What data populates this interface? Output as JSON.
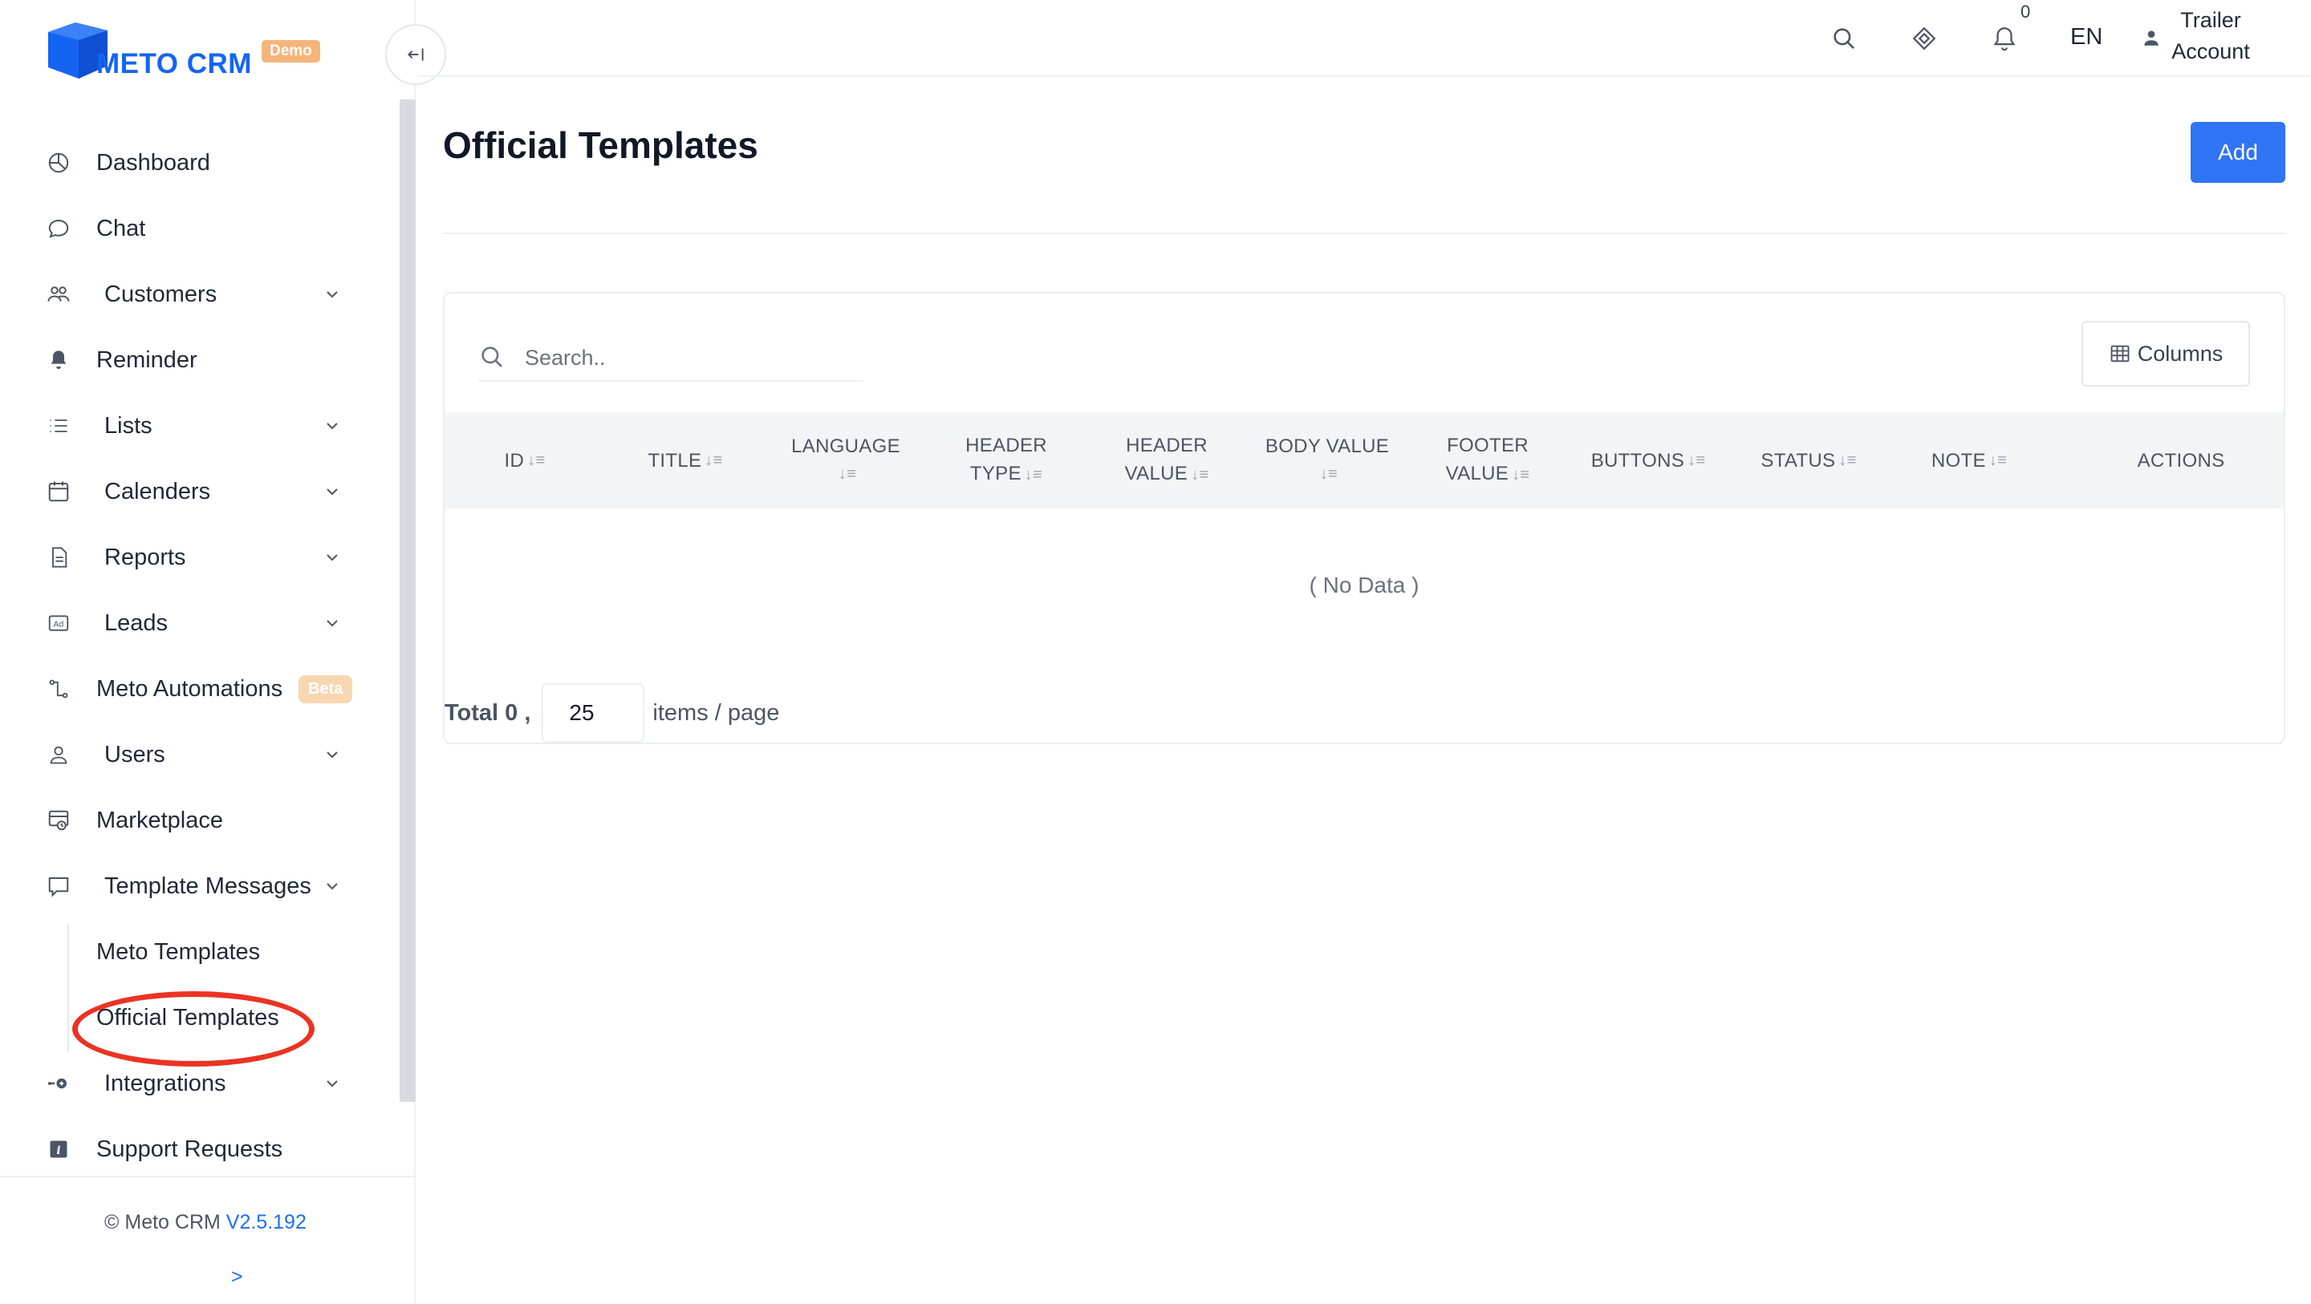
{
  "app": {
    "logo_text": "METO CRM",
    "logo_badge": "Demo",
    "brand_color": "#1464f4"
  },
  "sidebar": {
    "items": [
      {
        "label": "Dashboard",
        "icon": "dashboard-icon"
      },
      {
        "label": "Chat",
        "icon": "chat-icon"
      },
      {
        "label": "Customers",
        "icon": "customers-icon",
        "expandable": true
      },
      {
        "label": "Reminder",
        "icon": "bell-icon"
      },
      {
        "label": "Lists",
        "icon": "list-icon",
        "expandable": true
      },
      {
        "label": "Calenders",
        "icon": "calendar-icon",
        "expandable": true
      },
      {
        "label": "Reports",
        "icon": "report-icon",
        "expandable": true
      },
      {
        "label": "Leads",
        "icon": "ad-icon",
        "expandable": true
      },
      {
        "label": "Meto Automations",
        "icon": "automation-icon",
        "badge": "Beta"
      },
      {
        "label": "Users",
        "icon": "user-icon",
        "expandable": true
      },
      {
        "label": "Marketplace",
        "icon": "marketplace-icon"
      },
      {
        "label": "Template Messages",
        "icon": "template-message-icon",
        "expandable": true,
        "expanded": true
      },
      {
        "label": "Meto Templates",
        "sub": true
      },
      {
        "label": "Official Templates",
        "sub": true,
        "active": true
      },
      {
        "label": "Integrations",
        "icon": "integrations-icon",
        "expandable": true
      },
      {
        "label": "Support Requests",
        "icon": "info-icon"
      }
    ],
    "footer": {
      "copyright": "© Meto CRM",
      "version": "V2.5.192",
      "expand": ">"
    }
  },
  "topbar": {
    "notification_count": "0",
    "language": "EN",
    "user_line1": "Trailer",
    "user_line2": "Account"
  },
  "main": {
    "title": "Official Templates",
    "add_label": "Add",
    "search_placeholder": "Search..",
    "columns_label": "Columns",
    "table": {
      "headers": [
        {
          "line1": "ID",
          "line2": ""
        },
        {
          "line1": "TITLE",
          "line2": ""
        },
        {
          "line1": "LANGUAGE",
          "line2": ""
        },
        {
          "line1": "HEADER",
          "line2": "TYPE"
        },
        {
          "line1": "HEADER",
          "line2": "VALUE"
        },
        {
          "line1": "BODY VALUE",
          "line2": ""
        },
        {
          "line1": "FOOTER",
          "line2": "VALUE"
        },
        {
          "line1": "BUTTONS",
          "line2": ""
        },
        {
          "line1": "STATUS",
          "line2": ""
        },
        {
          "line1": "NOTE",
          "line2": ""
        },
        {
          "line1": "ACTIONS",
          "line2": ""
        }
      ],
      "rows": [],
      "empty_text": "( No Data )"
    },
    "pagination": {
      "total_label": "Total 0 ,",
      "page_size": "25",
      "per_page_label": "items / page"
    }
  },
  "accent_color": "#2f74f5",
  "highlight_color": "#ea3323"
}
